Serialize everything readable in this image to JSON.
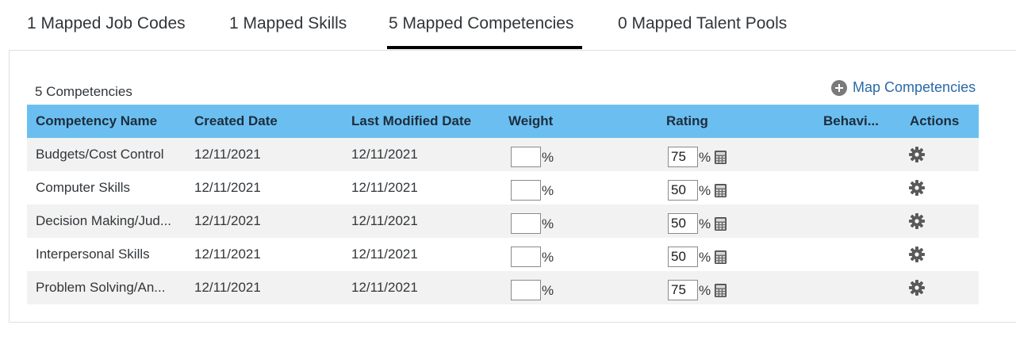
{
  "tabs": [
    {
      "label": "1 Mapped Job Codes"
    },
    {
      "label": "1 Mapped Skills"
    },
    {
      "label": "5 Mapped Competencies"
    },
    {
      "label": "0 Mapped Talent Pools"
    }
  ],
  "active_tab": "5 Mapped Competencies",
  "panel": {
    "count_label": "5 Competencies",
    "map_link_label": "Map Competencies",
    "map_link_icon": "plus-circle-icon"
  },
  "table": {
    "columns": [
      "Competency Name",
      "Created Date",
      "Last Modified Date",
      "Weight",
      "Rating",
      "Behavi...",
      "Actions"
    ],
    "percent_sign": "%",
    "rows": [
      {
        "name": "Budgets/Cost Control",
        "created": "12/11/2021",
        "modified": "12/11/2021",
        "weight": "",
        "rating": "75"
      },
      {
        "name": "Computer Skills",
        "created": "12/11/2021",
        "modified": "12/11/2021",
        "weight": "",
        "rating": "50"
      },
      {
        "name": "Decision Making/Jud...",
        "created": "12/11/2021",
        "modified": "12/11/2021",
        "weight": "",
        "rating": "50"
      },
      {
        "name": "Interpersonal Skills",
        "created": "12/11/2021",
        "modified": "12/11/2021",
        "weight": "",
        "rating": "50"
      },
      {
        "name": "Problem Solving/An...",
        "created": "12/11/2021",
        "modified": "12/11/2021",
        "weight": "",
        "rating": "75"
      }
    ]
  },
  "colors": {
    "header_bg": "#6bbff0",
    "link": "#2a6aa8",
    "alt_row": "#f2f2f2",
    "active_tab_underline": "#000000"
  },
  "icons": {
    "rating": "calculator-icon",
    "actions": "gear-icon"
  }
}
